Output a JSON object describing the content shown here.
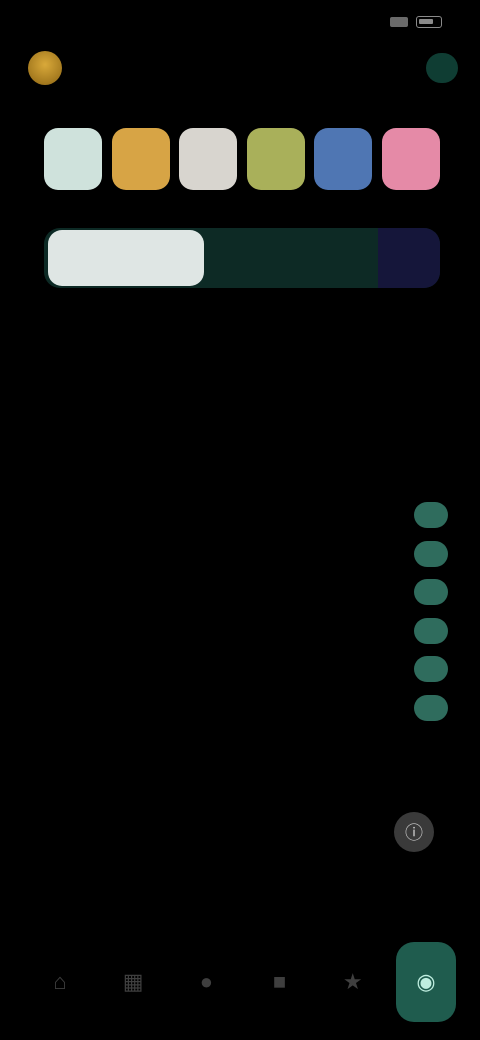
{
  "status_bar": {
    "time": "",
    "battery": ""
  },
  "header": {
    "title": "",
    "pill_label": ""
  },
  "swatches": [
    {
      "name": "mint",
      "color": "#cfe2dc"
    },
    {
      "name": "amber",
      "color": "#d7a445"
    },
    {
      "name": "cream",
      "color": "#d8d5cf"
    },
    {
      "name": "olive",
      "color": "#a9b05a"
    },
    {
      "name": "blue",
      "color": "#4f76b3"
    },
    {
      "name": "pink",
      "color": "#e58aa7"
    }
  ],
  "segmented": {
    "active_label": "",
    "middle_label": "",
    "end_label": ""
  },
  "settings": [
    {
      "label": "",
      "value": ""
    },
    {
      "label": "",
      "value": ""
    }
  ],
  "section": {
    "title": "",
    "items": [
      {
        "label": ""
      },
      {
        "label": ""
      },
      {
        "label": ""
      },
      {
        "label": ""
      },
      {
        "label": ""
      },
      {
        "label": ""
      }
    ]
  },
  "description": {
    "text": ""
  },
  "bottom_nav": {
    "items": [
      {
        "icon": "home-icon"
      },
      {
        "icon": "grid-icon"
      },
      {
        "icon": "circle-icon"
      },
      {
        "icon": "square-icon"
      },
      {
        "icon": "star-icon"
      },
      {
        "icon": "palette-icon",
        "active": true
      }
    ]
  },
  "colors": {
    "accent": "#59c9a5",
    "accent_dark": "#1f5c4e",
    "background": "#000000"
  }
}
